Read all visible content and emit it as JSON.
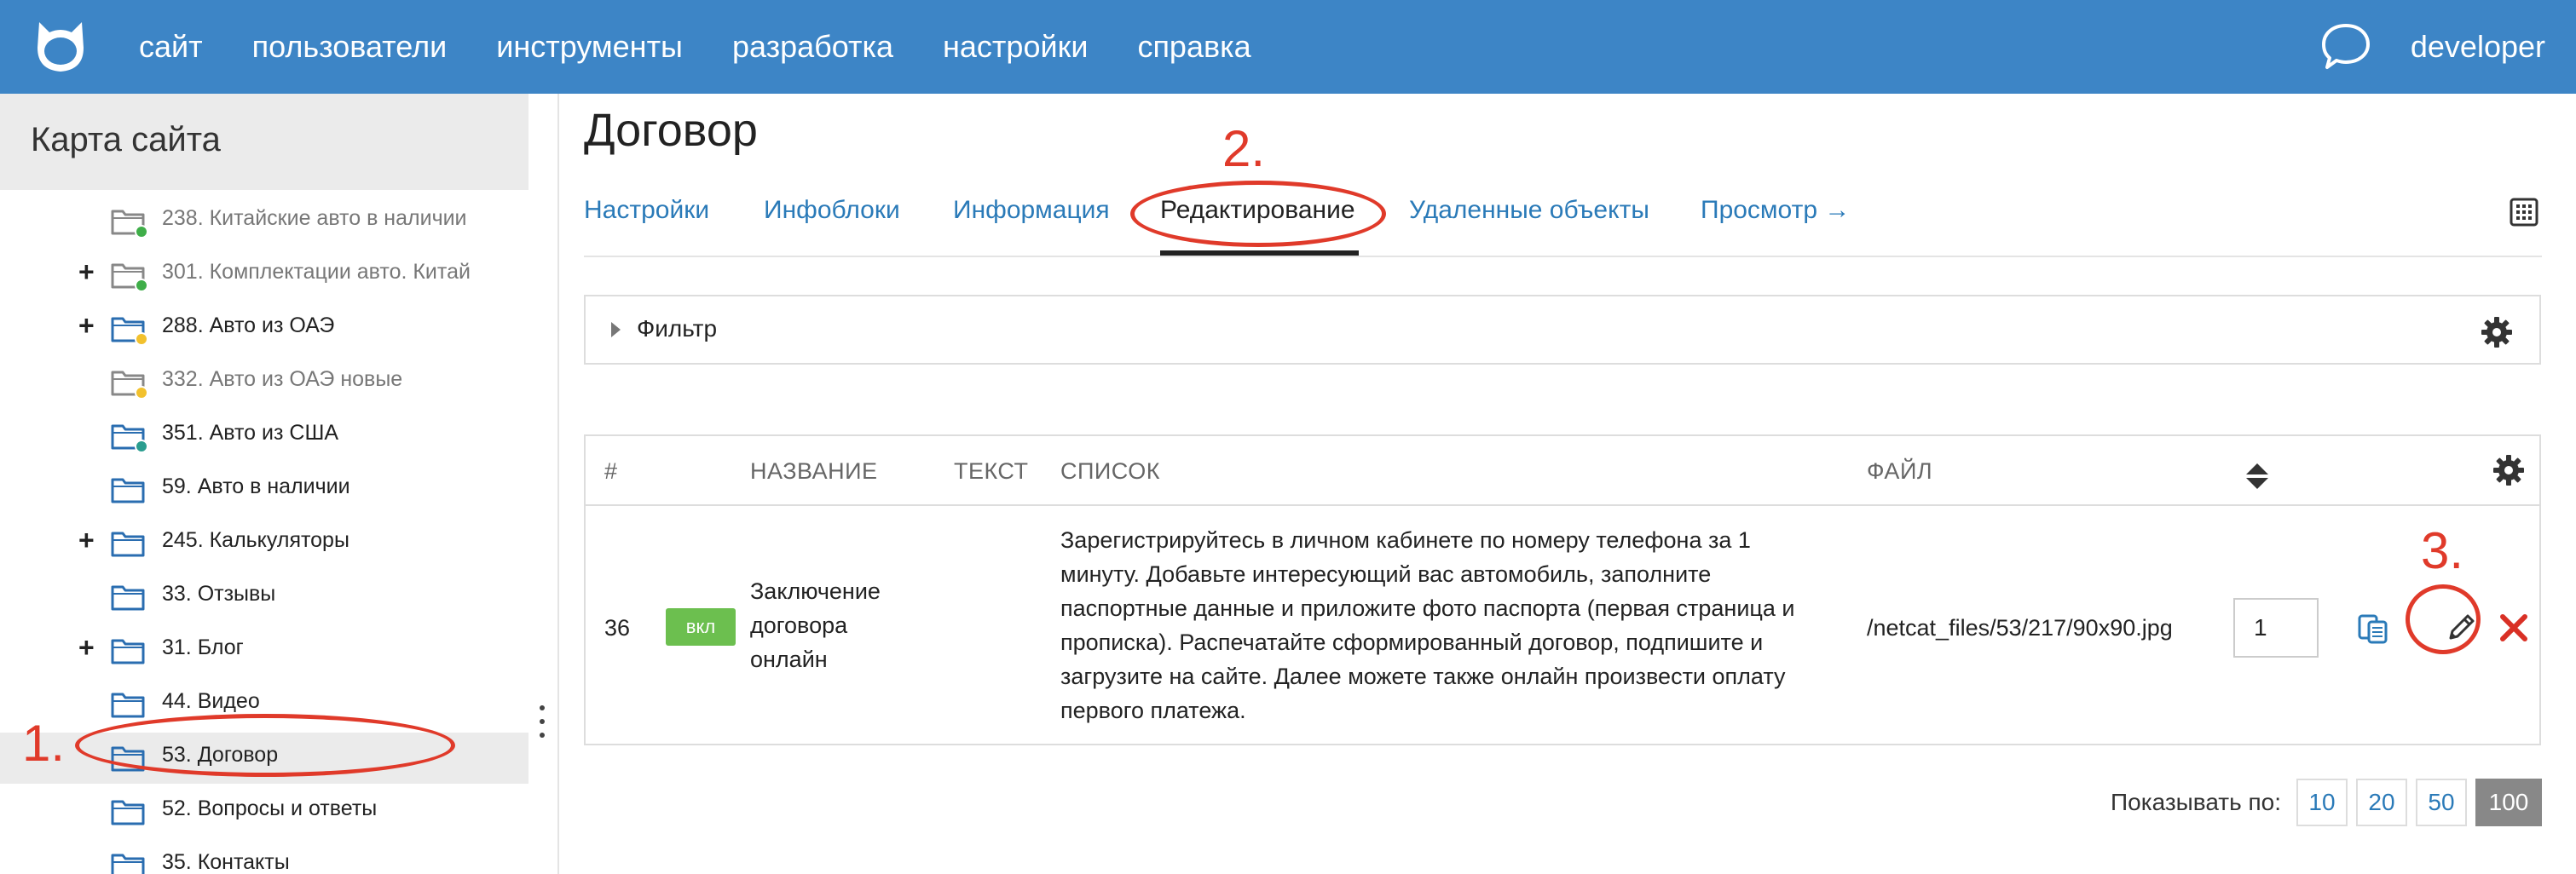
{
  "topbar": {
    "nav": [
      "сайт",
      "пользователи",
      "инструменты",
      "разработка",
      "настройки",
      "справка"
    ],
    "user": "developer",
    "brand_color": "#3d85c6"
  },
  "sidebar": {
    "title": "Карта сайта",
    "items": [
      {
        "label": "238. Китайские авто в наличии",
        "plus": "",
        "status": "green",
        "muted": true
      },
      {
        "label": "301. Комплектации авто. Китай",
        "plus": "+",
        "status": "green",
        "muted": true
      },
      {
        "label": "288. Авто из ОАЭ",
        "plus": "+",
        "status": "yellow",
        "muted": false
      },
      {
        "label": "332. Авто из ОАЭ новые",
        "plus": "",
        "status": "yellow",
        "muted": true
      },
      {
        "label": "351. Авто из США",
        "plus": "",
        "status": "teal",
        "muted": false
      },
      {
        "label": "59. Авто в наличии",
        "plus": "",
        "status": "",
        "muted": false
      },
      {
        "label": "245. Калькуляторы",
        "plus": "+",
        "status": "",
        "muted": false
      },
      {
        "label": "33. Отзывы",
        "plus": "",
        "status": "",
        "muted": false
      },
      {
        "label": "31. Блог",
        "plus": "+",
        "status": "",
        "muted": false
      },
      {
        "label": "44. Видео",
        "plus": "",
        "status": "",
        "muted": false
      },
      {
        "label": "53. Договор",
        "plus": "",
        "status": "",
        "muted": false,
        "selected": true
      },
      {
        "label": "52. Вопросы и ответы",
        "plus": "",
        "status": "",
        "muted": false
      },
      {
        "label": "35. Контакты",
        "plus": "",
        "status": "",
        "muted": false
      }
    ]
  },
  "main": {
    "title": "Договор",
    "tabs": [
      "Настройки",
      "Инфоблоки",
      "Информация",
      "Редактирование",
      "Удаленные объекты",
      "Просмотр →"
    ],
    "active_tab": "Редактирование",
    "filter_label": "Фильтр",
    "table": {
      "headers": {
        "num": "#",
        "name": "НАЗВАНИЕ",
        "text": "ТЕКСТ",
        "list": "СПИСОК",
        "file": "ФАЙЛ"
      },
      "row": {
        "id": "36",
        "badge": "вкл",
        "name": [
          "Заключение",
          "договора",
          "онлайн"
        ],
        "list": [
          "Зарегистрируйтесь в личном кабинете по номеру телефона за 1",
          "минуту. Добавьте интересующий вас автомобиль, заполните",
          "паспортные данные и приложите фото паспорта (первая страница и",
          "прописка). Распечатайте сформированный договор, подпишите и",
          "загрузите на сайте. Далее можете также онлайн произвести оплату",
          "первого платежа."
        ],
        "file": "/netcat_files/53/217/90x90.jpg",
        "priority": "1"
      }
    },
    "pager": {
      "label": "Показывать по:",
      "options": [
        "10",
        "20",
        "50",
        "100"
      ],
      "active": "100"
    }
  },
  "annotations": {
    "one": "1.",
    "two": "2.",
    "three": "3.",
    "color": "#e03a2a"
  }
}
